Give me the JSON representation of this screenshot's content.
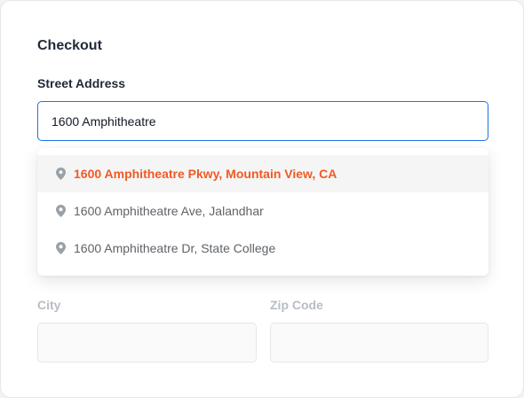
{
  "checkout": {
    "title": "Checkout",
    "street_label": "Street Address",
    "street_value": "1600 Amphitheatre",
    "suggestions": [
      {
        "text": "1600 Amphitheatre Pkwy, Mountain View, CA",
        "icon": "map-pin-icon",
        "highlighted": true
      },
      {
        "text": "1600 Amphitheatre Ave, Jalandhar",
        "icon": "map-pin-icon",
        "highlighted": false
      },
      {
        "text": "1600 Amphitheatre Dr, State College",
        "icon": "map-pin-icon",
        "highlighted": false
      }
    ],
    "city_label": "City",
    "city_value": "",
    "zip_label": "Zip Code",
    "zip_value": ""
  },
  "colors": {
    "accent": "#1a73e8",
    "highlight": "#f15a24",
    "muted_label": "#b8bcc4"
  }
}
